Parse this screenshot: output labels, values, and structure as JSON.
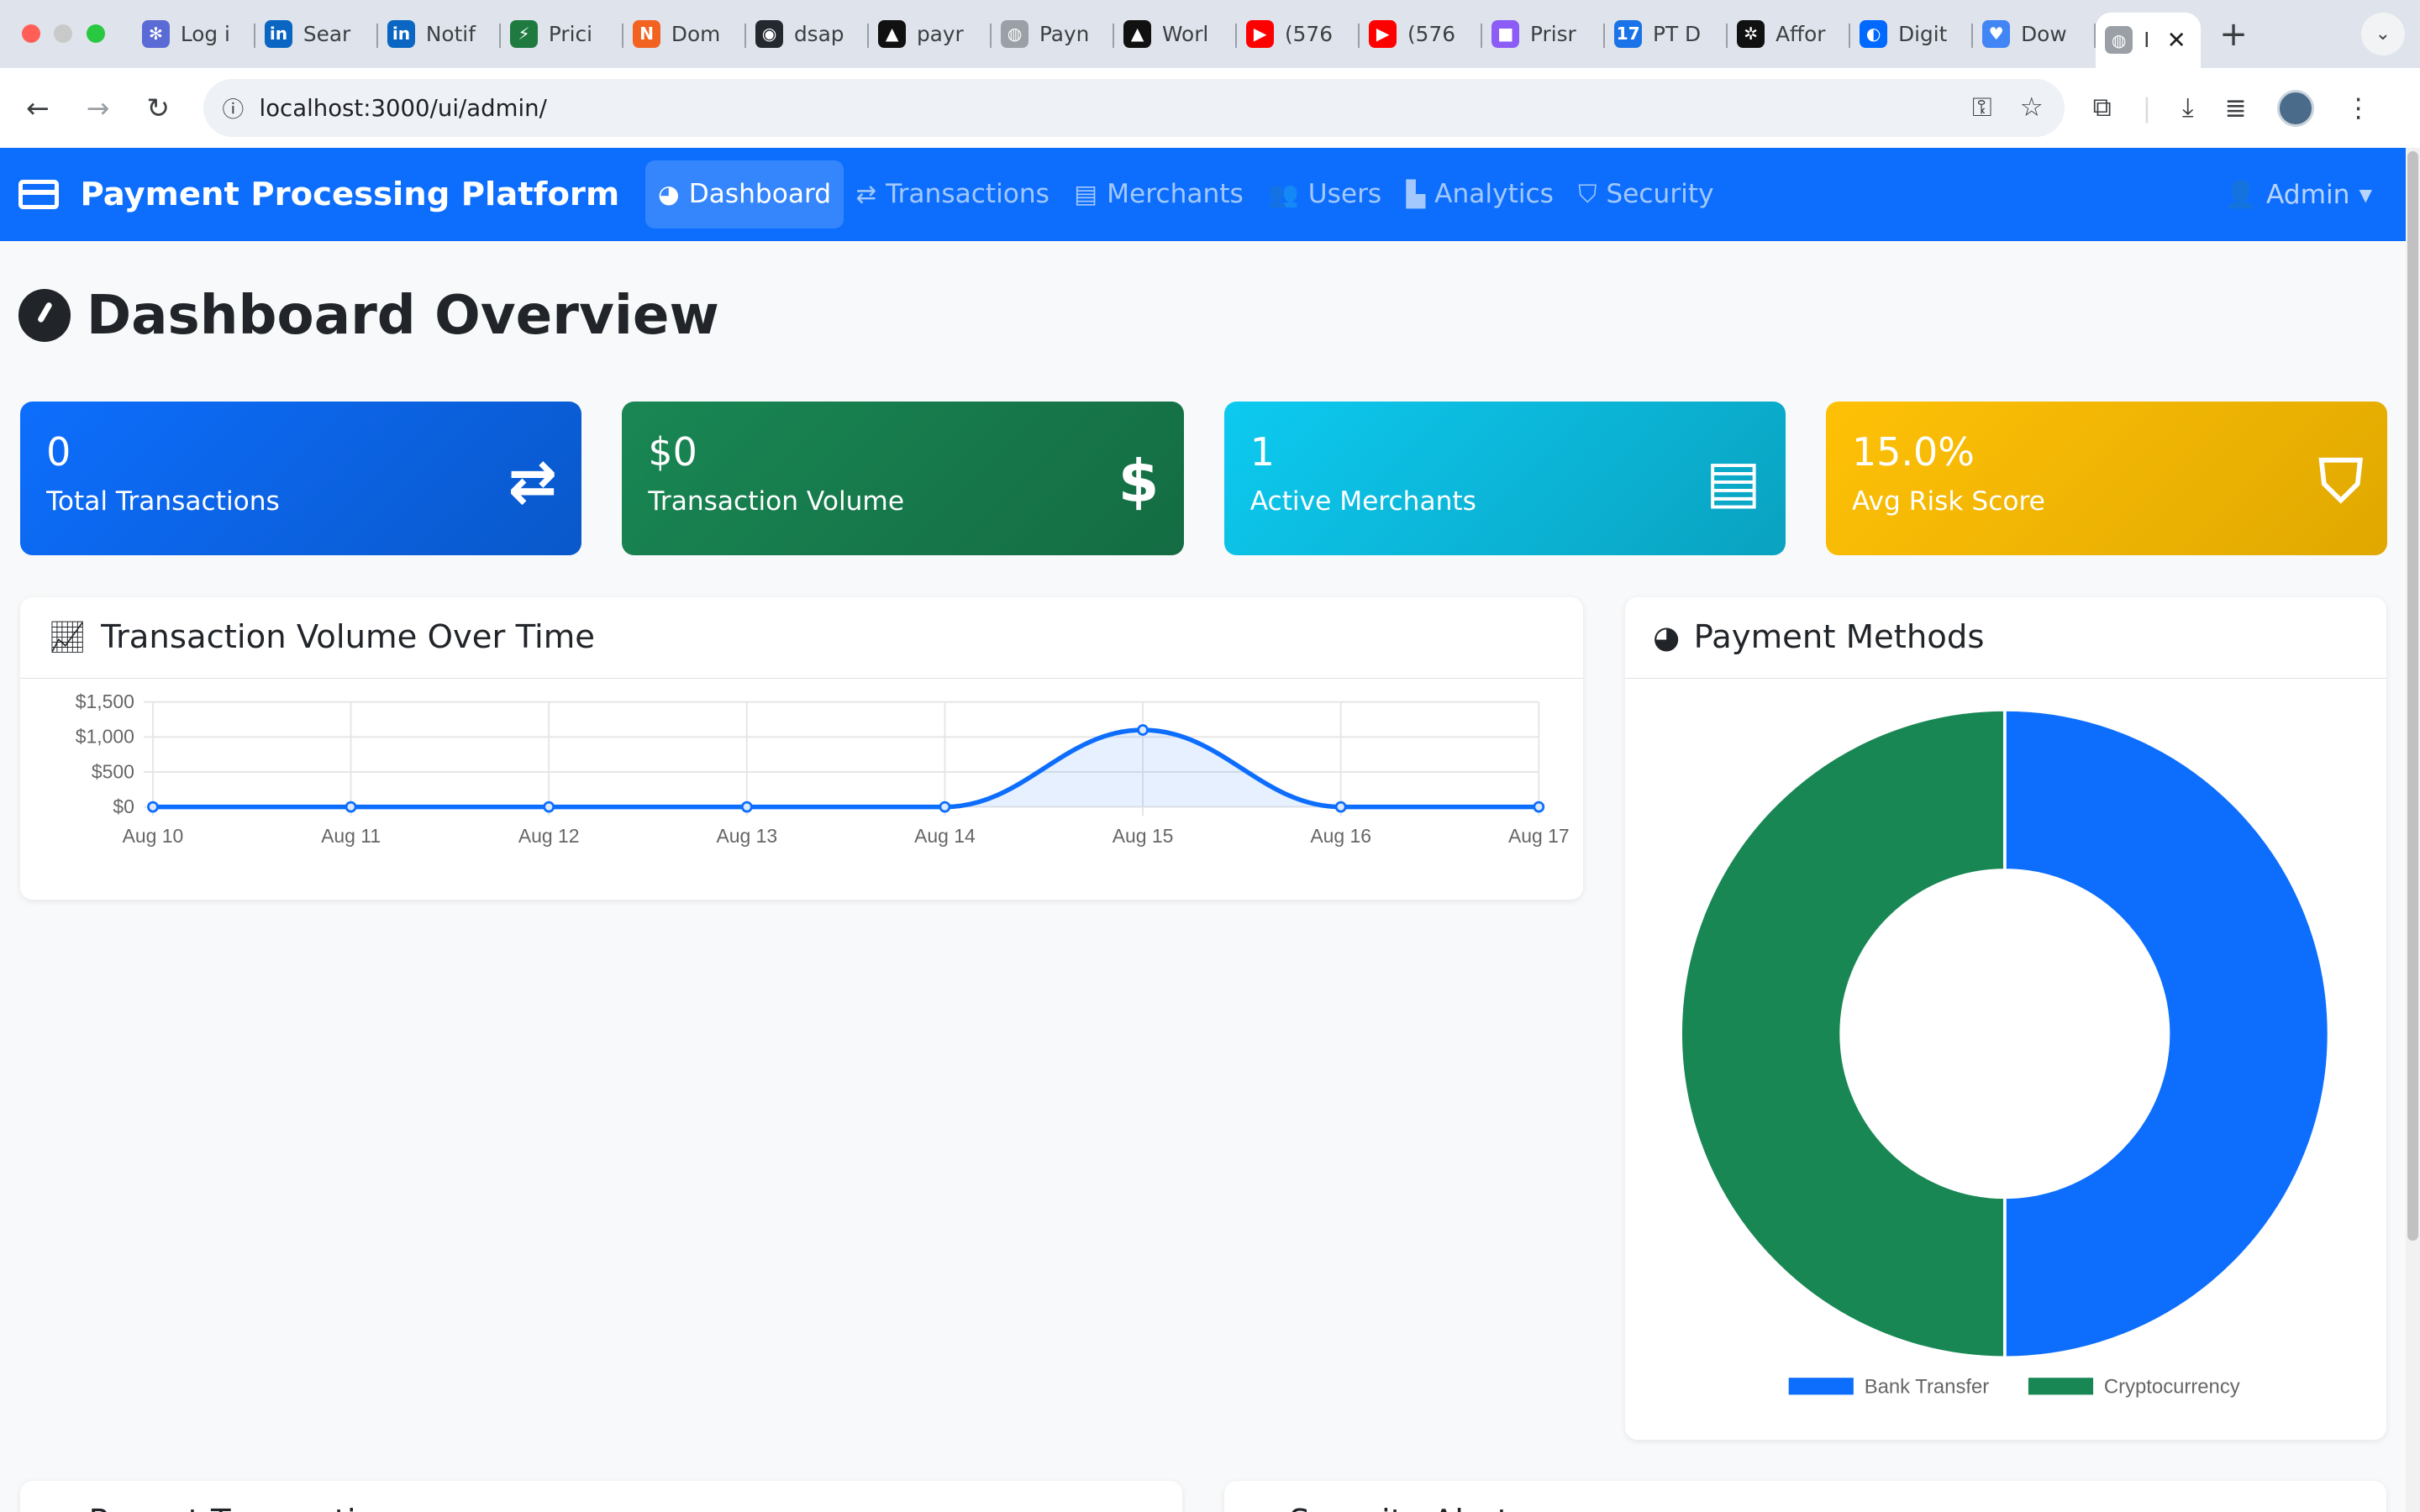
{
  "browser": {
    "tabs": [
      {
        "label": "Log i",
        "color": "#5b6bd6",
        "glyph": "✻"
      },
      {
        "label": "Sear",
        "color": "#0a66c2",
        "glyph": "in"
      },
      {
        "label": "Notif",
        "color": "#0a66c2",
        "glyph": "in"
      },
      {
        "label": "Prici",
        "color": "#1f7a3f",
        "glyph": "⚡"
      },
      {
        "label": "Dom",
        "color": "#f26322",
        "glyph": "N"
      },
      {
        "label": "dsap",
        "color": "#24292f",
        "glyph": "◉"
      },
      {
        "label": "payr",
        "color": "#111111",
        "glyph": "▲"
      },
      {
        "label": "Payn",
        "color": "#9aa0a6",
        "glyph": "◍"
      },
      {
        "label": "Worl",
        "color": "#111111",
        "glyph": "▲"
      },
      {
        "label": "(576",
        "color": "#ff0000",
        "glyph": "▶"
      },
      {
        "label": "(576",
        "color": "#ff0000",
        "glyph": "▶"
      },
      {
        "label": "Prisr",
        "color": "#8b5cf6",
        "glyph": "■"
      },
      {
        "label": "PT D",
        "color": "#1a73e8",
        "glyph": "17"
      },
      {
        "label": "Affor",
        "color": "#111111",
        "glyph": "✲"
      },
      {
        "label": "Digit",
        "color": "#0069ff",
        "glyph": "◐"
      },
      {
        "label": "Dow",
        "color": "#4285f4",
        "glyph": "♥"
      }
    ],
    "active_tab": {
      "label": "I",
      "close": "✕"
    },
    "new_tab": "+",
    "url": "localhost:3000/ui/admin/"
  },
  "navbar": {
    "brand": "Payment Processing Platform",
    "links": [
      {
        "label": "Dashboard",
        "icon": "gauge-icon",
        "glyph": "◕"
      },
      {
        "label": "Transactions",
        "icon": "exchange-icon",
        "glyph": "⇄"
      },
      {
        "label": "Merchants",
        "icon": "store-icon",
        "glyph": "▤"
      },
      {
        "label": "Users",
        "icon": "users-icon",
        "glyph": "👥"
      },
      {
        "label": "Analytics",
        "icon": "bar-chart-icon",
        "glyph": "▙"
      },
      {
        "label": "Security",
        "icon": "shield-icon",
        "glyph": "⛉"
      }
    ],
    "user": "Admin"
  },
  "page": {
    "title": "Dashboard Overview"
  },
  "stats": [
    {
      "value": "0",
      "label": "Total Transactions",
      "icon": "exchange-icon",
      "glyph": "⇄"
    },
    {
      "value": "$0",
      "label": "Transaction Volume",
      "icon": "dollar-icon",
      "glyph": "$"
    },
    {
      "value": "1",
      "label": "Active Merchants",
      "icon": "store-icon",
      "glyph": "▤"
    },
    {
      "value": "15.0%",
      "label": "Avg Risk Score",
      "icon": "shield-icon",
      "glyph": "⛉"
    }
  ],
  "cards": {
    "volume_title": "Transaction Volume Over Time",
    "methods_title": "Payment Methods",
    "recent_title": "Recent Transactions",
    "alerts_title": "Security Alerts"
  },
  "chart_data": [
    {
      "type": "line",
      "title": "Transaction Volume Over Time",
      "x": [
        "Aug 10",
        "Aug 11",
        "Aug 12",
        "Aug 13",
        "Aug 14",
        "Aug 15",
        "Aug 16",
        "Aug 17"
      ],
      "series": [
        {
          "values": [
            0,
            0,
            0,
            0,
            0,
            1100,
            0,
            0
          ]
        }
      ],
      "yticks": [
        "$0",
        "$500",
        "$1,000",
        "$1,500"
      ],
      "ylim": [
        0,
        1500
      ],
      "grid": true,
      "color": "#0d6efd"
    },
    {
      "type": "pie",
      "title": "Payment Methods",
      "categories": [
        "Bank Transfer",
        "Cryptocurrency"
      ],
      "values": [
        50,
        50
      ],
      "colors": [
        "#0d6efd",
        "#198754"
      ],
      "legend": "bottom"
    }
  ]
}
